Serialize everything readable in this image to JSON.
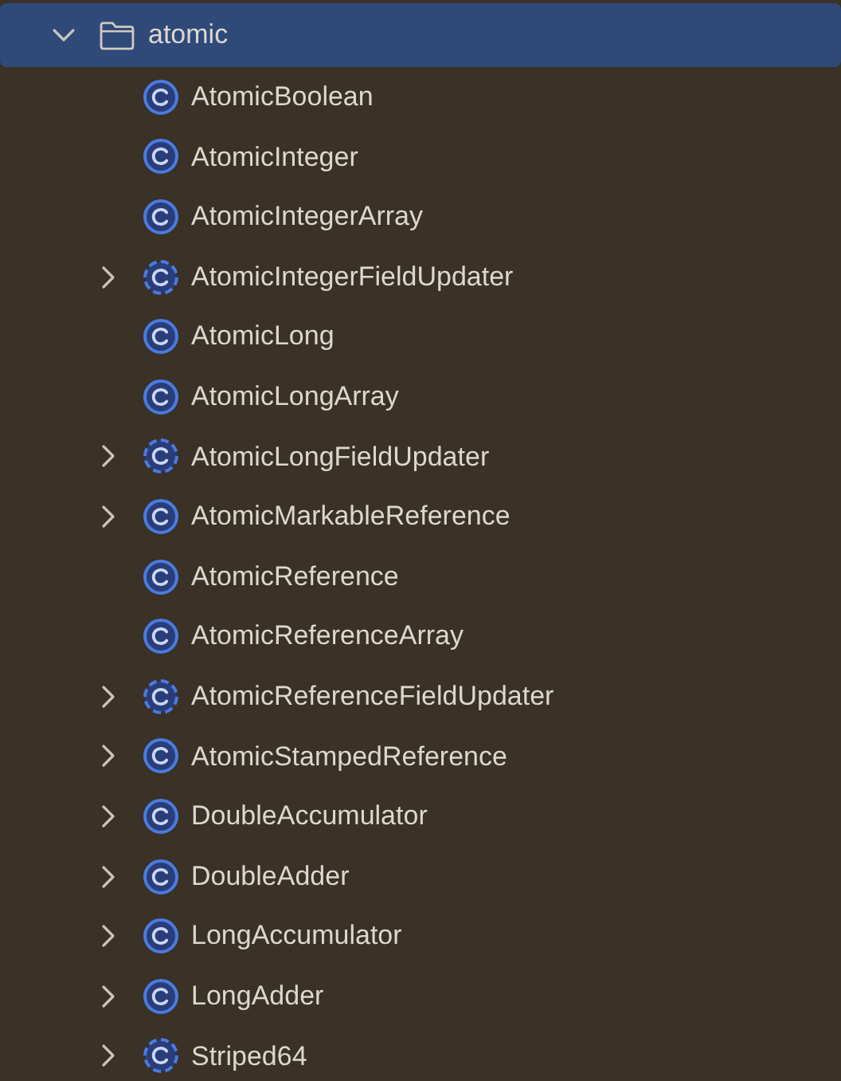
{
  "tree": [
    {
      "label": "atomic",
      "kind": "folder",
      "expanded": true,
      "selected": true,
      "children": [
        {
          "label": "AtomicBoolean",
          "kind": "class",
          "expandable": false
        },
        {
          "label": "AtomicInteger",
          "kind": "class",
          "expandable": false
        },
        {
          "label": "AtomicIntegerArray",
          "kind": "class",
          "expandable": false
        },
        {
          "label": "AtomicIntegerFieldUpdater",
          "kind": "abstract",
          "expandable": true
        },
        {
          "label": "AtomicLong",
          "kind": "class",
          "expandable": false
        },
        {
          "label": "AtomicLongArray",
          "kind": "class",
          "expandable": false
        },
        {
          "label": "AtomicLongFieldUpdater",
          "kind": "abstract",
          "expandable": true
        },
        {
          "label": "AtomicMarkableReference",
          "kind": "class",
          "expandable": true
        },
        {
          "label": "AtomicReference",
          "kind": "class",
          "expandable": false
        },
        {
          "label": "AtomicReferenceArray",
          "kind": "class",
          "expandable": false
        },
        {
          "label": "AtomicReferenceFieldUpdater",
          "kind": "abstract",
          "expandable": true
        },
        {
          "label": "AtomicStampedReference",
          "kind": "class",
          "expandable": true
        },
        {
          "label": "DoubleAccumulator",
          "kind": "class",
          "expandable": true
        },
        {
          "label": "DoubleAdder",
          "kind": "class",
          "expandable": true
        },
        {
          "label": "LongAccumulator",
          "kind": "class",
          "expandable": true
        },
        {
          "label": "LongAdder",
          "kind": "class",
          "expandable": true
        },
        {
          "label": "Striped64",
          "kind": "abstract",
          "expandable": true
        }
      ]
    }
  ]
}
